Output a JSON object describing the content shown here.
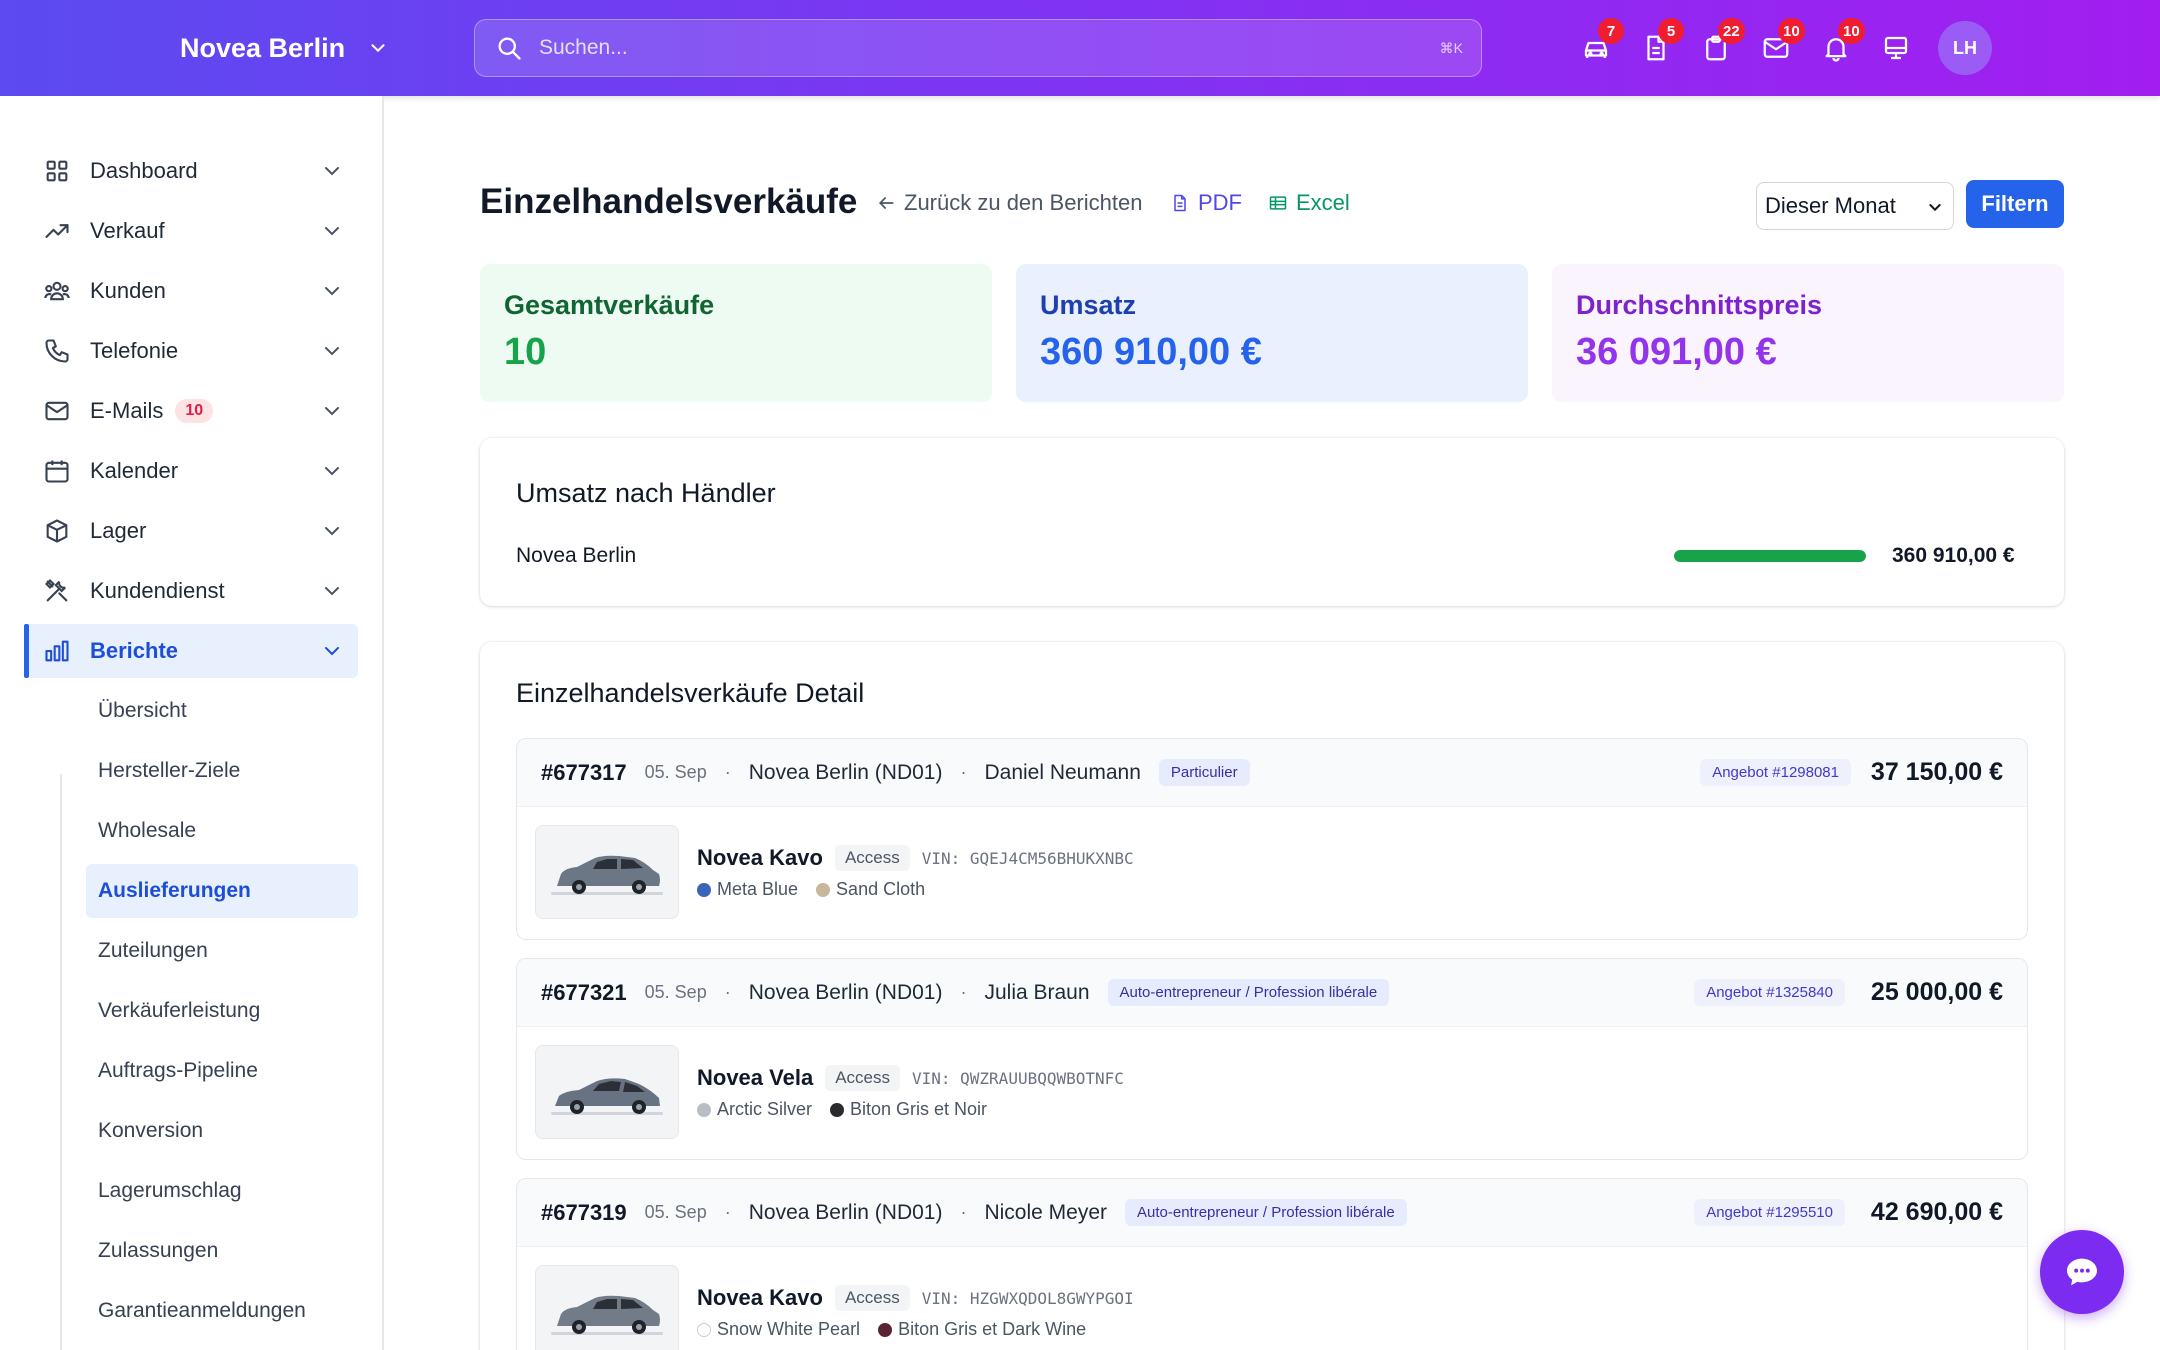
{
  "header": {
    "brand": "Novea Berlin",
    "search_placeholder": "Suchen...",
    "search_shortcut": "⌘K",
    "icons": [
      {
        "name": "car-icon",
        "badge": "7"
      },
      {
        "name": "document-icon",
        "badge": "5"
      },
      {
        "name": "clipboard-icon",
        "badge": "22"
      },
      {
        "name": "mail-icon",
        "badge": "10"
      },
      {
        "name": "bell-icon",
        "badge": "10"
      },
      {
        "name": "monitor-icon",
        "badge": ""
      }
    ],
    "avatar_initials": "LH"
  },
  "sidebar": {
    "items": [
      {
        "label": "Dashboard",
        "icon": "grid-icon"
      },
      {
        "label": "Verkauf",
        "icon": "trending-up-icon"
      },
      {
        "label": "Kunden",
        "icon": "users-icon"
      },
      {
        "label": "Telefonie",
        "icon": "phone-icon"
      },
      {
        "label": "E-Mails",
        "icon": "mail-icon",
        "badge": "10"
      },
      {
        "label": "Kalender",
        "icon": "calendar-icon"
      },
      {
        "label": "Lager",
        "icon": "box-icon"
      },
      {
        "label": "Kundendienst",
        "icon": "tools-icon"
      },
      {
        "label": "Berichte",
        "icon": "bar-chart-icon",
        "active": true
      }
    ],
    "subitems": [
      {
        "label": "Übersicht"
      },
      {
        "label": "Hersteller-Ziele"
      },
      {
        "label": "Wholesale"
      },
      {
        "label": "Auslieferungen",
        "active": true
      },
      {
        "label": "Zuteilungen"
      },
      {
        "label": "Verkäuferleistung"
      },
      {
        "label": "Auftrags-Pipeline"
      },
      {
        "label": "Konversion"
      },
      {
        "label": "Lagerumschlag"
      },
      {
        "label": "Zulassungen"
      },
      {
        "label": "Garantieanmeldungen"
      }
    ]
  },
  "page": {
    "title": "Einzelhandelsverkäufe",
    "back_link": "Zurück zu den Berichten",
    "pdf_label": "PDF",
    "excel_label": "Excel",
    "period_selected": "Dieser Monat",
    "filter_button": "Filtern"
  },
  "stats": {
    "total_label": "Gesamtverkäufe",
    "total_value": "10",
    "revenue_label": "Umsatz",
    "revenue_value": "360 910,00 €",
    "avg_label": "Durchschnittspreis",
    "avg_value": "36 091,00 €",
    "colors": {
      "green": "#16a34a",
      "blue": "#2563eb",
      "purple": "#9333ea"
    }
  },
  "dealer_card": {
    "title": "Umsatz nach Händler",
    "rows": [
      {
        "name": "Novea Berlin",
        "value": "360 910,00 €",
        "share": 1.0
      }
    ]
  },
  "detail": {
    "title": "Einzelhandelsverkäufe Detail",
    "sales": [
      {
        "id": "#677317",
        "date": "05. Sep",
        "dealer": "Novea Berlin (ND01)",
        "customer": "Daniel Neumann",
        "customer_type": "Particulier",
        "offer": "Angebot #1298081",
        "price": "37 150,00 €",
        "model": "Novea Kavo",
        "trim": "Access",
        "vin": "VIN: GQEJ4CM56BHUKXNBC",
        "colors": [
          {
            "name": "Meta Blue",
            "hex": "#3b63b8"
          },
          {
            "name": "Sand Cloth",
            "hex": "#c8b79a"
          }
        ]
      },
      {
        "id": "#677321",
        "date": "05. Sep",
        "dealer": "Novea Berlin (ND01)",
        "customer": "Julia Braun",
        "customer_type": "Auto-entrepreneur / Profession libérale",
        "offer": "Angebot #1325840",
        "price": "25 000,00 €",
        "model": "Novea Vela",
        "trim": "Access",
        "vin": "VIN: QWZRAUUBQQWBOTNFC",
        "colors": [
          {
            "name": "Arctic Silver",
            "hex": "#b8bcc4"
          },
          {
            "name": "Biton Gris et Noir",
            "hex": "#2b2b2e"
          }
        ]
      },
      {
        "id": "#677319",
        "date": "05. Sep",
        "dealer": "Novea Berlin (ND01)",
        "customer": "Nicole Meyer",
        "customer_type": "Auto-entrepreneur / Profession libérale",
        "offer": "Angebot #1295510",
        "price": "42 690,00 €",
        "model": "Novea Kavo",
        "trim": "Access",
        "vin": "VIN: HZGWXQDOL8GWYPGOI",
        "colors": [
          {
            "name": "Snow White Pearl",
            "hex": "#ffffff"
          },
          {
            "name": "Biton Gris et Dark Wine",
            "hex": "#5a2430"
          }
        ]
      }
    ]
  }
}
